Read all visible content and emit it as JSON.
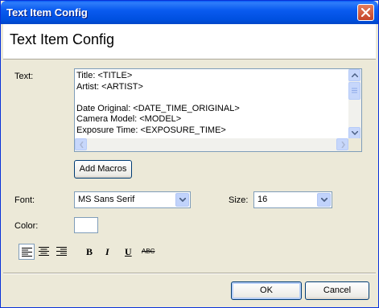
{
  "window": {
    "title": "Text Item Config",
    "close_icon": "close-icon"
  },
  "header": {
    "heading": "Text Item Config"
  },
  "form": {
    "text_label": "Text:",
    "text_lines": [
      "Title: <TITLE>",
      "Artist: <ARTIST>",
      "",
      "Date Original: <DATE_TIME_ORIGINAL>",
      "Camera Model: <MODEL>",
      "Exposure Time: <EXPOSURE_TIME>"
    ],
    "add_macros_label": "Add Macros",
    "font_label": "Font:",
    "font_value": "MS Sans Serif",
    "size_label": "Size:",
    "size_value": "16",
    "color_label": "Color:",
    "color_value": "#ffffff",
    "bold_label": "B",
    "italic_label": "I",
    "underline_label": "U",
    "strike_label": "ABC"
  },
  "footer": {
    "ok_label": "OK",
    "cancel_label": "Cancel"
  }
}
